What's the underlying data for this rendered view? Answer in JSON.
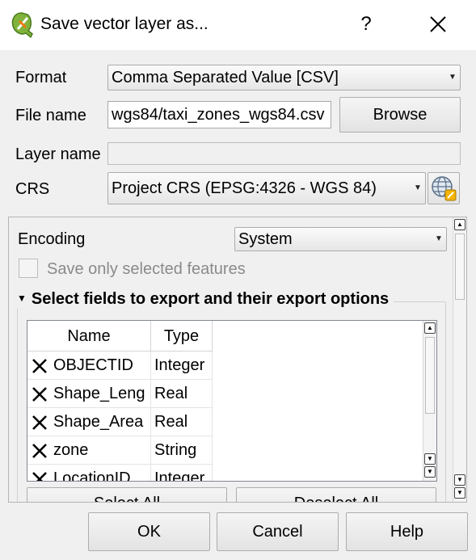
{
  "window": {
    "title": "Save vector layer as...",
    "help_label": "?"
  },
  "form": {
    "format_label": "Format",
    "format_value": "Comma Separated Value [CSV]",
    "filename_label": "File name",
    "filename_value": "wgs84/taxi_zones_wgs84.csv",
    "browse_label": "Browse",
    "layername_label": "Layer name",
    "layername_value": "",
    "crs_label": "CRS",
    "crs_value": "Project CRS (EPSG:4326 - WGS 84)"
  },
  "options": {
    "encoding_label": "Encoding",
    "encoding_value": "System",
    "selected_only_label": "Save only selected features",
    "selected_only_checked": false,
    "fields_group_title": "Select fields to export and their export options",
    "fields_group_expanded": true,
    "table": {
      "headers": [
        "Name",
        "Type"
      ],
      "rows": [
        {
          "checked": true,
          "name": "OBJECTID",
          "type": "Integer"
        },
        {
          "checked": true,
          "name": "Shape_Leng",
          "type": "Real"
        },
        {
          "checked": true,
          "name": "Shape_Area",
          "type": "Real"
        },
        {
          "checked": true,
          "name": "zone",
          "type": "String"
        },
        {
          "checked": true,
          "name": "LocationID",
          "type": "Integer"
        }
      ]
    },
    "select_all_label": "Select All",
    "deselect_all_label": "Deselect All"
  },
  "footer": {
    "ok_label": "OK",
    "cancel_label": "Cancel",
    "help_label": "Help"
  },
  "colors": {
    "dialog_bg": "#f0f0f0",
    "titlebar_bg": "#ffffff",
    "field_bg": "#ffffff",
    "border": "#acacac"
  },
  "icons": {
    "app": "qgis-logo-icon",
    "crs_selector": "globe-projection-icon",
    "close": "close-icon",
    "dropdown": "dropdown-arrow-icon",
    "expand": "triangle-down-icon",
    "checkbox_checked": "x-check-icon"
  }
}
